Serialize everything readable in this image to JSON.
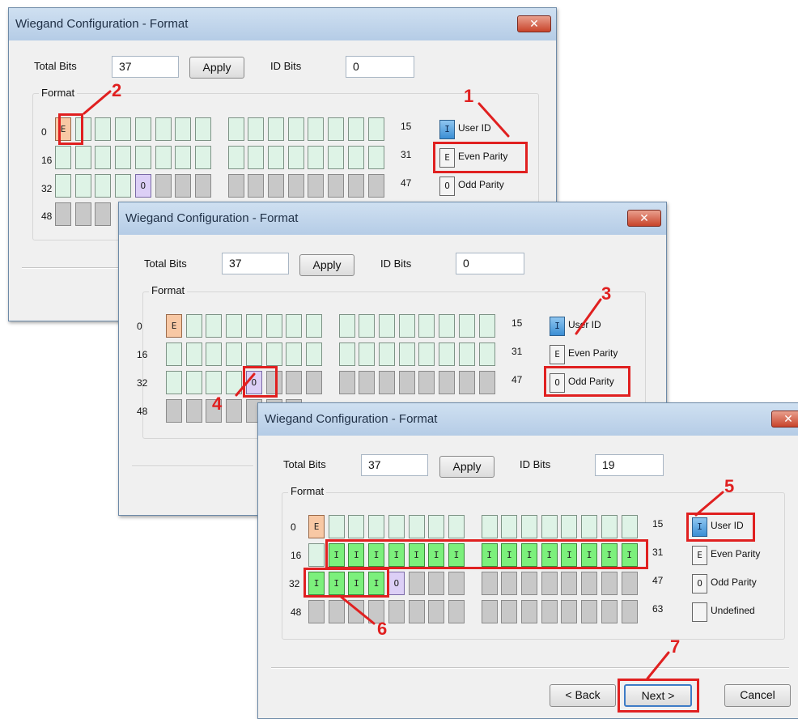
{
  "dialog_title": "Wiegand Configuration - Format",
  "close_glyph": "✕",
  "labels": {
    "total_bits": "Total Bits",
    "id_bits": "ID Bits",
    "apply": "Apply",
    "format": "Format"
  },
  "row_labels": [
    "0",
    "16",
    "32",
    "48"
  ],
  "row_ends": [
    "15",
    "31",
    "47",
    "63"
  ],
  "legend": {
    "user_id": {
      "glyph": "I",
      "label": "User ID"
    },
    "even": {
      "glyph": "E",
      "label": "Even Parity"
    },
    "odd": {
      "glyph": "O",
      "label": "Odd Parity"
    },
    "undefined": {
      "glyph": "",
      "label": "Undefined"
    }
  },
  "dialogs": [
    {
      "total_bits": "37",
      "id_bits": "0"
    },
    {
      "total_bits": "37",
      "id_bits": "0"
    },
    {
      "total_bits": "37",
      "id_bits": "19"
    }
  ],
  "buttons": {
    "back": "< Back",
    "next": "Next >",
    "cancel": "Cancel"
  },
  "callouts": [
    "1",
    "2",
    "3",
    "4",
    "5",
    "6",
    "7"
  ],
  "colors": {
    "highlight": "#e02020",
    "cell_free": "#def3e6",
    "cell_even": "#f8c8a4",
    "cell_odd": "#dccff6",
    "cell_id": "#7cf07c",
    "cell_unused": "#c8c8c8"
  }
}
